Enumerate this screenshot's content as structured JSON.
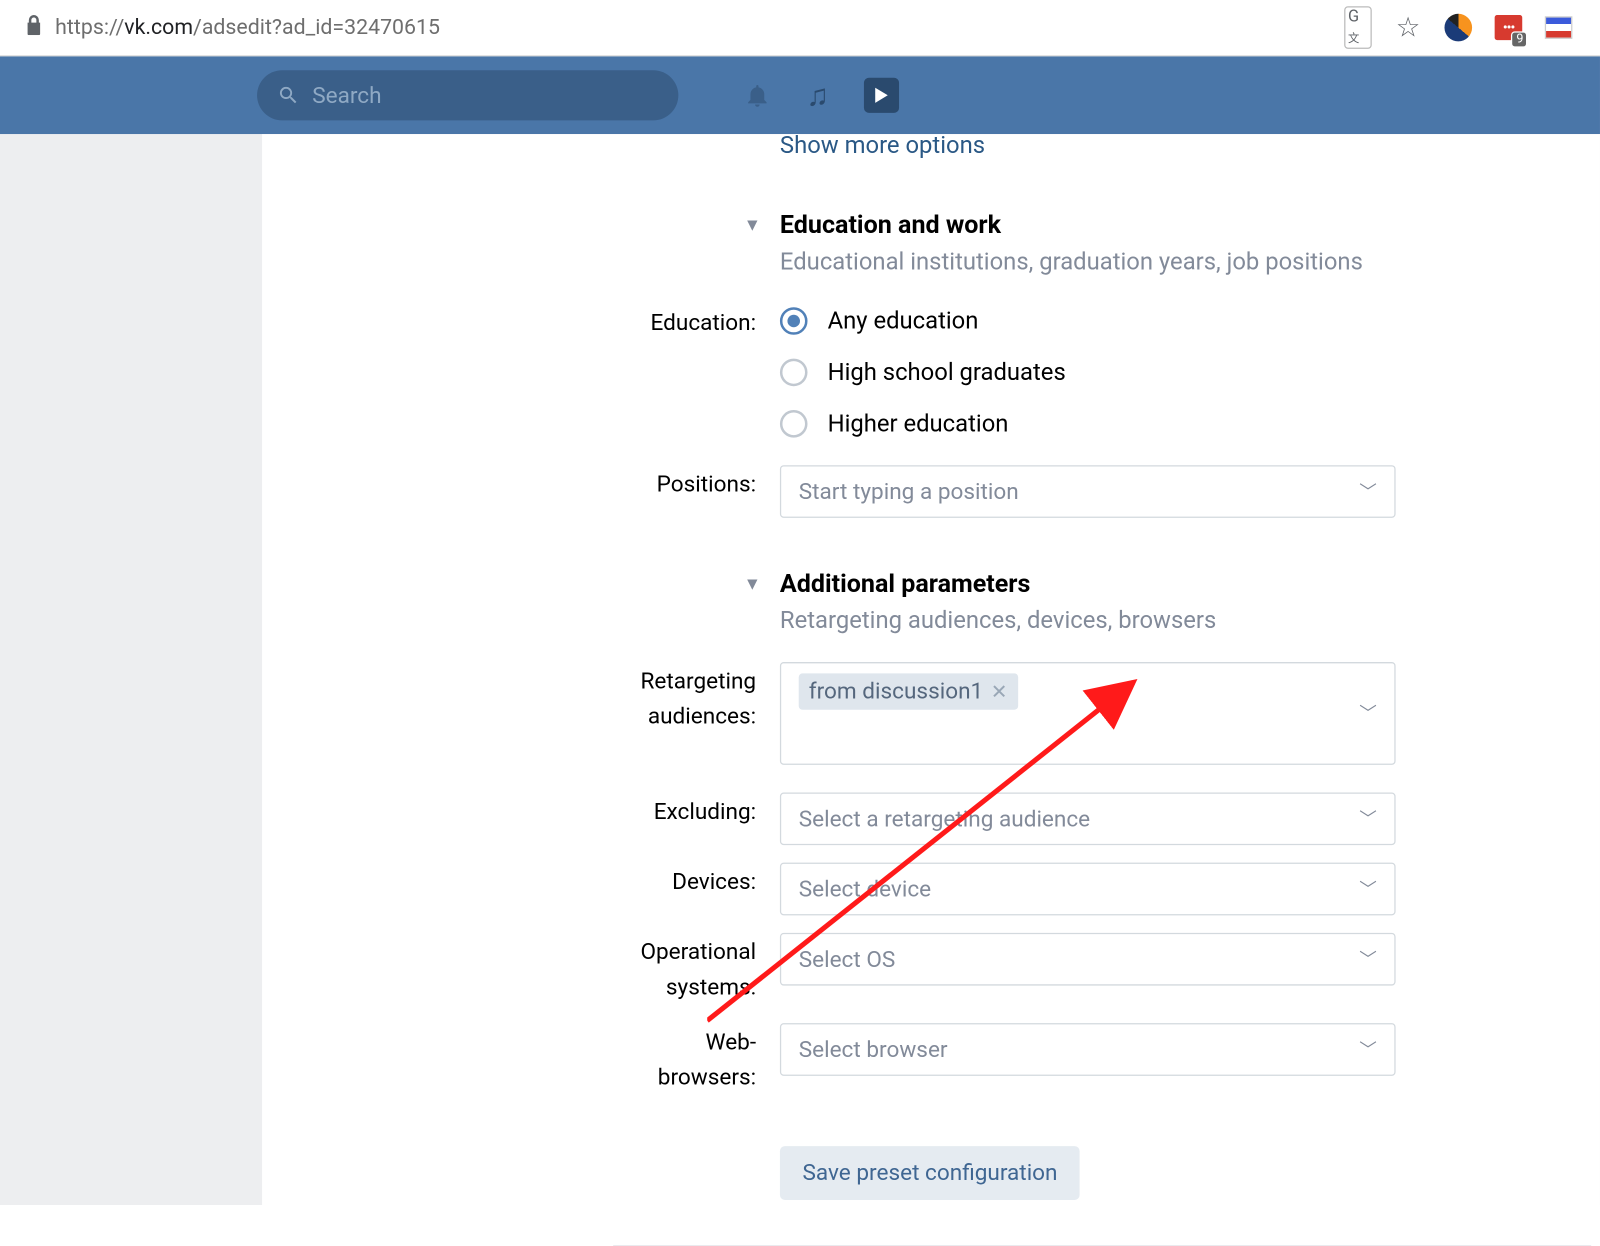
{
  "browser": {
    "url_prefix": "https://",
    "url_host": "vk.com",
    "url_path": "/adsedit?ad_id=32470615",
    "badge_count": "9"
  },
  "navbar": {
    "search_placeholder": "Search"
  },
  "link_more": "Show more options",
  "section_edu": {
    "title": "Education and work",
    "subtitle": "Educational institutions, graduation years, job positions",
    "education_label": "Education:",
    "radios": {
      "any": "Any education",
      "highschool": "High school graduates",
      "higher": "Higher education"
    },
    "positions_label": "Positions:",
    "positions_placeholder": "Start typing a position"
  },
  "section_add": {
    "title": "Additional parameters",
    "subtitle": "Retargeting audiences, devices, browsers",
    "retargeting_label": "Retargeting audiences:",
    "retargeting_tag": "from discussion1",
    "excluding_label": "Excluding:",
    "excluding_placeholder": "Select a retargeting audience",
    "devices_label": "Devices:",
    "devices_placeholder": "Select device",
    "os_label": "Operational systems:",
    "os_placeholder": "Select OS",
    "browsers_label": "Web-browsers:",
    "browsers_placeholder": "Select browser"
  },
  "save_button": "Save preset configuration"
}
